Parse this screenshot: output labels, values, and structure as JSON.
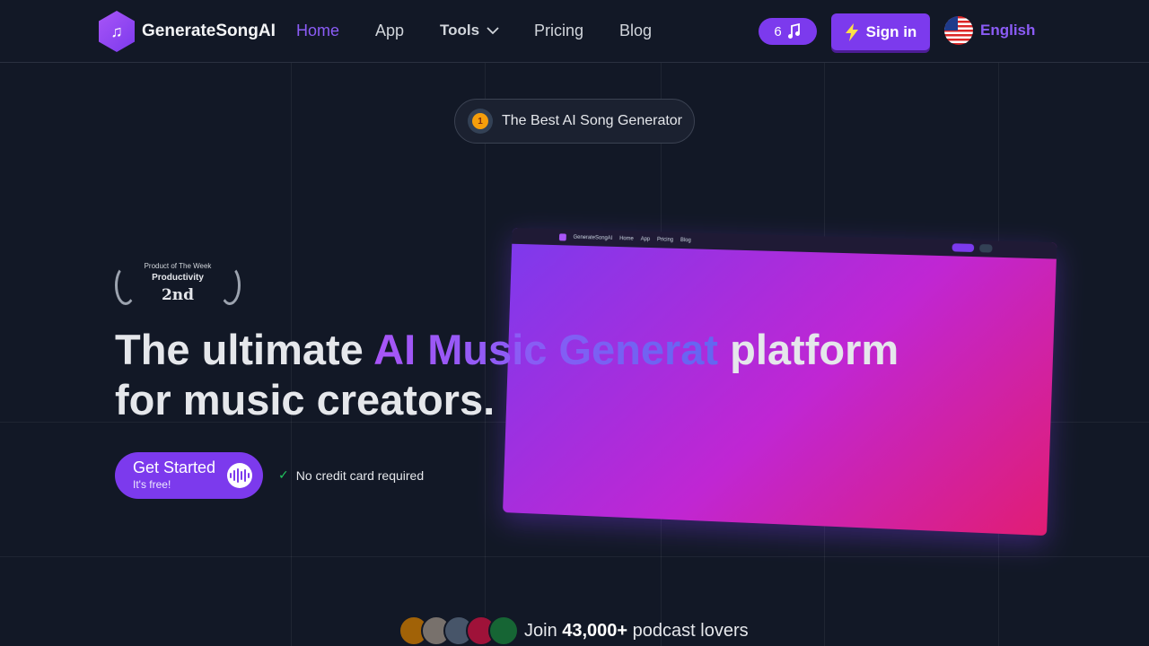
{
  "nav": {
    "brand": "GenerateSongAI",
    "links": [
      {
        "label": "Home",
        "active": true
      },
      {
        "label": "App"
      },
      {
        "label": "Tools"
      },
      {
        "label": "Pricing"
      },
      {
        "label": "Blog"
      }
    ],
    "credits": "6",
    "signin_label": "Sign in",
    "language": "English"
  },
  "badge": {
    "text": "The Best AI Song Generator",
    "medal_number": "1"
  },
  "award": {
    "top": "Product of The Week",
    "category": "Productivity",
    "rank": "2nd"
  },
  "preview_nav": {
    "brand": "GenerateSongAI",
    "links": [
      "Home",
      "App",
      "Pricing",
      "Blog"
    ]
  },
  "hero": {
    "headline_start": "The ultimate ",
    "headline_accent": "AI Music Generat",
    "headline_end": " platform",
    "headline_line2": "for music creators."
  },
  "cta": {
    "main": "Get Started",
    "sub": "It's free!",
    "note": "No credit card required"
  },
  "social": {
    "prefix": "Join ",
    "count": "43,000+",
    "suffix": " podcast lovers"
  },
  "colors": {
    "accent": "#7c3aed",
    "background": "#121826",
    "gradient_end": "#e11d74"
  }
}
